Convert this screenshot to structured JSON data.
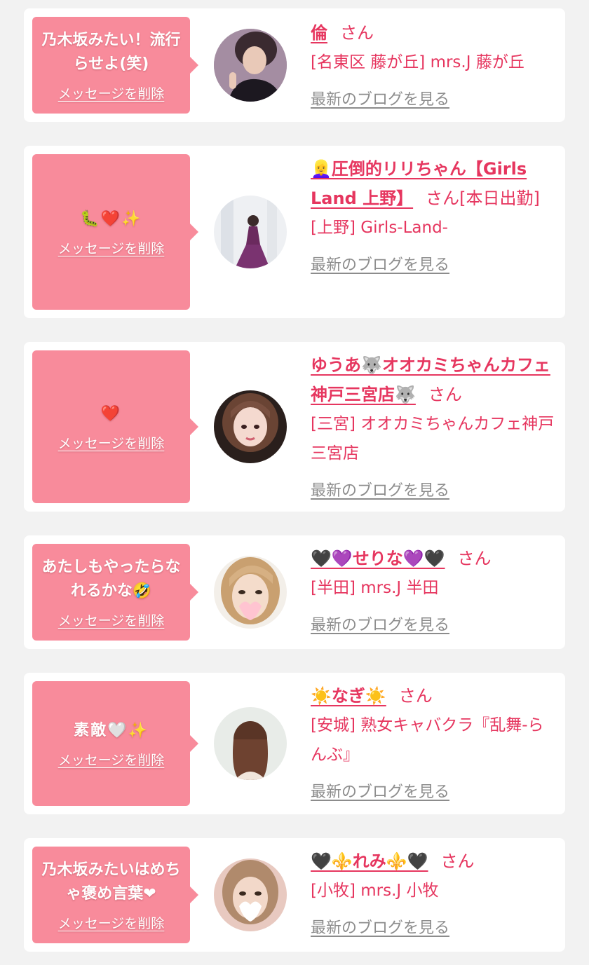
{
  "delete_label": "メッセージを削除",
  "san_label": "さん",
  "blog_label": "最新のブログを見る",
  "colors": {
    "bubble": "#f88b9b",
    "name": "#e6365f",
    "blog": "#8c8c8c",
    "background": "#f2f2f2"
  },
  "items": [
    {
      "message": "乃木坂みたい！流行らせよ(笑)",
      "name": "倫",
      "tag": "",
      "shop": "[名東区 藤が丘] mrs.J 藤が丘"
    },
    {
      "message": "🐛❤️✨",
      "name": "👱‍♀️圧倒的リリちゃん【Girls Land 上野】",
      "tag": "[本日出勤]",
      "shop": "[上野] Girls-Land-"
    },
    {
      "message": "❤️",
      "name": "ゆうあ🐺オオカミちゃんカフェ神戸三宮店🐺",
      "tag": "",
      "shop": "[三宮] オオカミちゃんカフェ神戸三宮店"
    },
    {
      "message": "あたしもやったらなれるかな🤣",
      "name": "🖤💜せりな💜🖤",
      "tag": "",
      "shop": "[半田] mrs.J 半田"
    },
    {
      "message": "素敵🤍✨",
      "name": "☀️なぎ☀️",
      "tag": "",
      "shop": "[安城] 熟女キャバクラ『乱舞-らんぶ』"
    },
    {
      "message": "乃木坂みたいはめちゃ褒め言葉❤",
      "name": "🖤⚜️れみ⚜️🖤",
      "tag": "",
      "shop": "[小牧] mrs.J 小牧"
    }
  ]
}
